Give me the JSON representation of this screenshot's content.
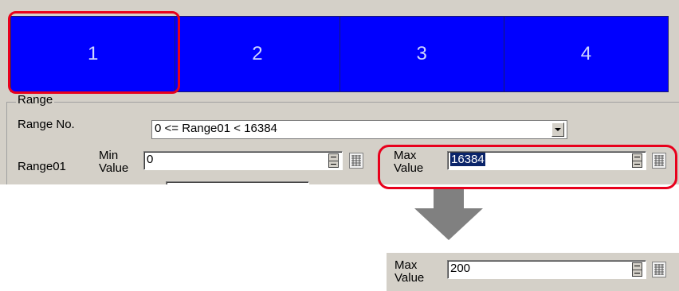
{
  "tabs": [
    "1",
    "2",
    "3",
    "4"
  ],
  "range": {
    "group_title": "Range",
    "range_no_label": "Range No.",
    "range_no_value": "0 <= Range01 < 16384",
    "row_label": "Range01",
    "min_label_1": "Min",
    "min_label_2": "Value",
    "min_value": "0",
    "max_label_1": "Max",
    "max_label_2": "Value",
    "max_value": "16384"
  },
  "result": {
    "max_label_1": "Max",
    "max_label_2": "Value",
    "max_value": "200"
  },
  "colors": {
    "tab_blue": "#0000ff",
    "highlight_red": "#e8001c",
    "arrow_gray": "#808080",
    "panel_gray": "#d4d0c8"
  },
  "icons": [
    "chevron-down-icon",
    "spin-icon",
    "keypad-icon",
    "arrow-down-icon"
  ]
}
